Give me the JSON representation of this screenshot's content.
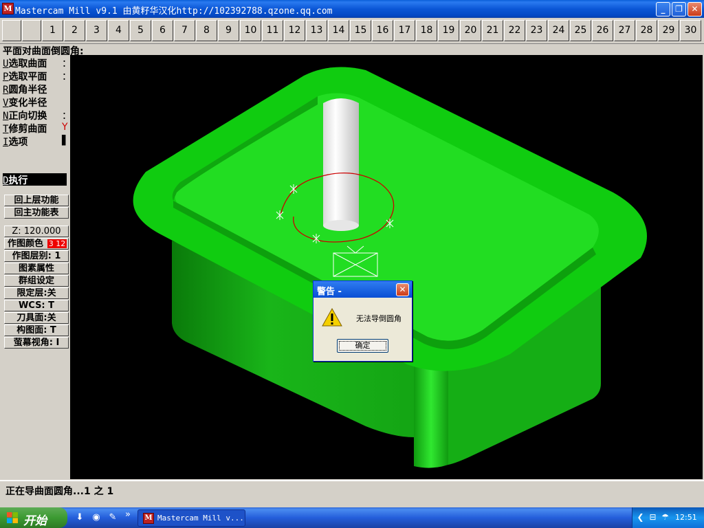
{
  "window": {
    "title": "Mastercam Mill v9.1 由黄籽华汉化http://102392788.qzone.qq.com",
    "icon_text": "M",
    "controls": [
      "minimize-icon",
      "restore-icon",
      "close-icon"
    ]
  },
  "toolbar": {
    "blank_buttons": 2,
    "numbers": [
      "1",
      "2",
      "3",
      "4",
      "5",
      "6",
      "7",
      "8",
      "9",
      "10",
      "11",
      "12",
      "13",
      "14",
      "15",
      "16",
      "17",
      "18",
      "19",
      "20",
      "21",
      "22",
      "23",
      "24",
      "25",
      "26",
      "27",
      "28",
      "29",
      "30"
    ]
  },
  "prompt": "平面对曲面倒圆角:",
  "menu": {
    "items": [
      {
        "key": "U",
        "label": "选取曲面",
        "value": "："
      },
      {
        "key": "P",
        "label": "选取平面",
        "value": "："
      },
      {
        "key": "R",
        "label": "圆角半径",
        "value": ""
      },
      {
        "key": "V",
        "label": "变化半径",
        "value": ""
      },
      {
        "key": "N",
        "label": "正向切换",
        "value": "："
      },
      {
        "key": "T",
        "label": "修剪曲面",
        "value": "Y"
      },
      {
        "key": "I",
        "label": "选项",
        "value": "▌"
      }
    ],
    "execute": {
      "key": "D",
      "label": "执行"
    },
    "nav": [
      "回上层功能",
      "回主功能表"
    ],
    "settings": [
      {
        "label": "Z: 120.000"
      },
      {
        "label": "作图颜色",
        "color_value": "3 12"
      },
      {
        "label": "作图层别: 1"
      },
      {
        "label": "图素属性"
      },
      {
        "label": "群组设定"
      },
      {
        "label": "限定层:关"
      },
      {
        "label": "WCS:  T"
      },
      {
        "label": "刀具面:关"
      },
      {
        "label": "构图面: T"
      },
      {
        "label": "萤幕视角: I"
      }
    ]
  },
  "dialog": {
    "title": "警告 -",
    "message": "无法导倒圆角",
    "ok_label": "确定",
    "icon": "warning-icon"
  },
  "status": "正在导曲面圆角...1 之 1",
  "taskbar": {
    "start_label": "开始",
    "quicklaunch": [
      "download-icon",
      "browser-icon",
      "tool-icon"
    ],
    "overflow": "»",
    "task_label": "Mastercam Mill v...",
    "clock": "12:51",
    "tray_icons": [
      "chevron-left-icon",
      "network-icon",
      "volume-icon"
    ]
  },
  "colors": {
    "part_green": "#00cc00",
    "viewport_bg": "#000000",
    "curve_red": "#cc0000"
  }
}
